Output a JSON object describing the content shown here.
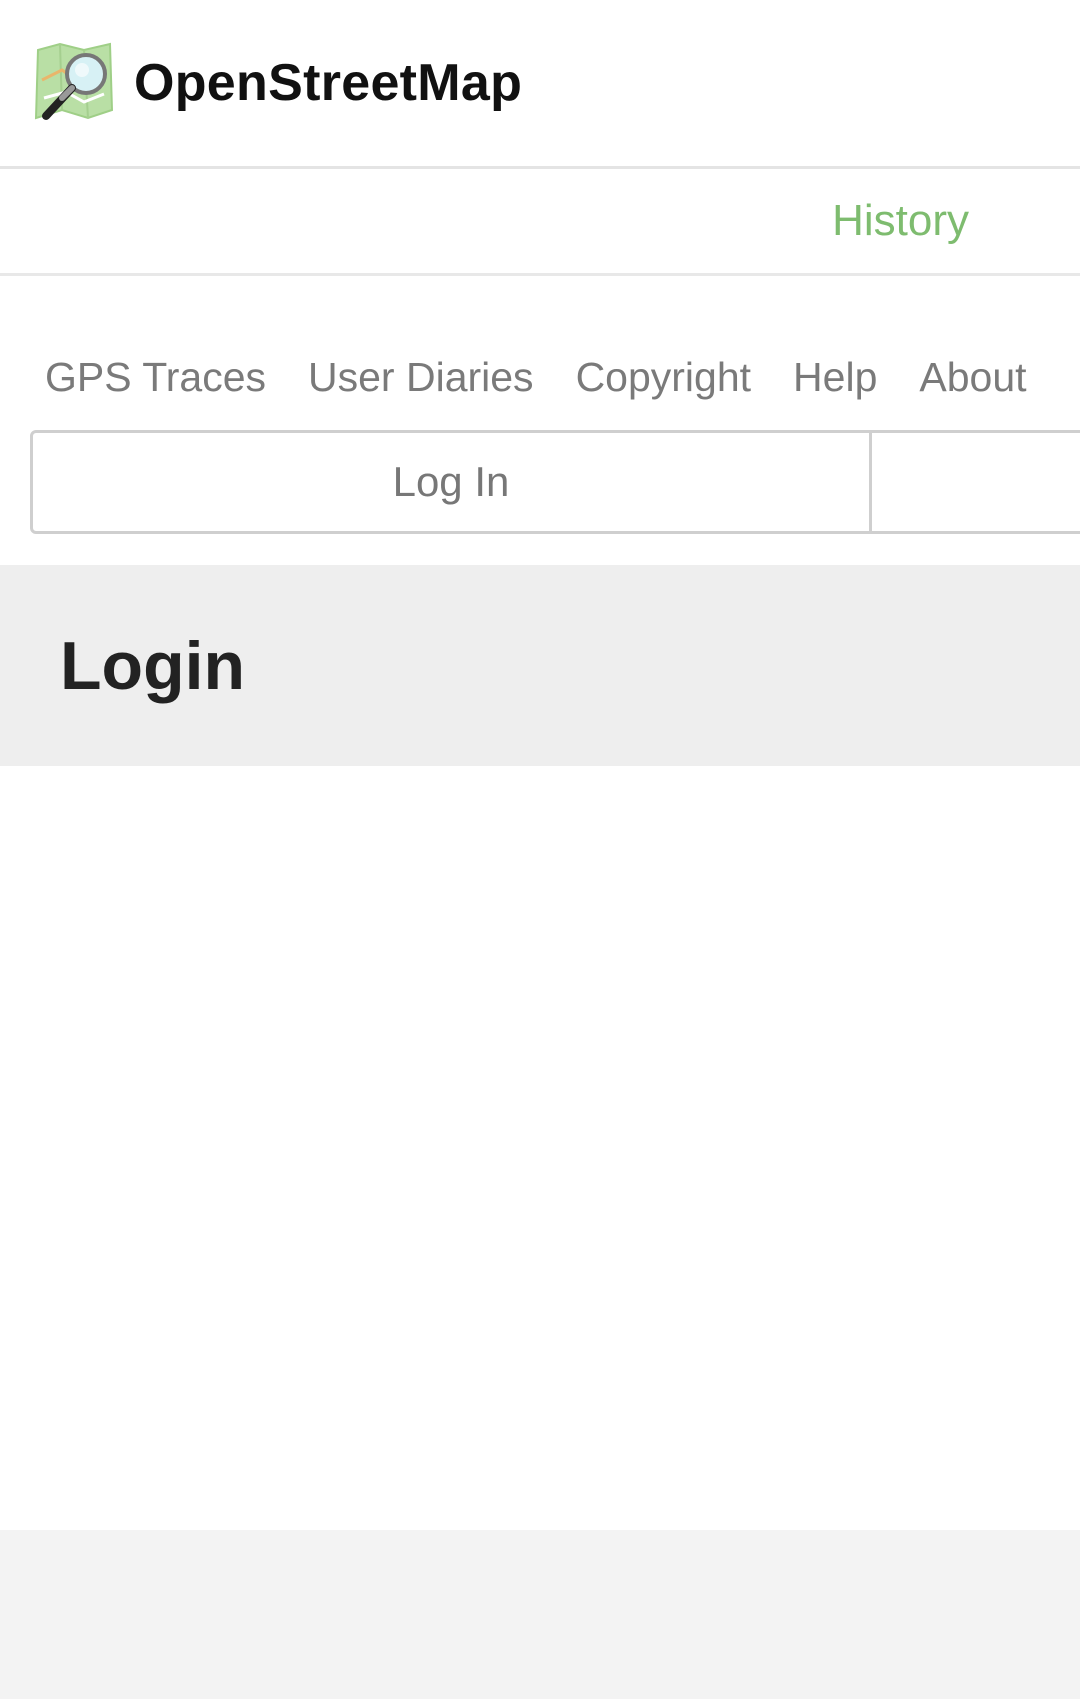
{
  "header": {
    "brand": "OpenStreetMap",
    "logo_icon": "osm-map-magnifier-icon"
  },
  "tabs": {
    "history": "History"
  },
  "nav": {
    "links": [
      "GPS Traces",
      "User Diaries",
      "Copyright",
      "Help",
      "About"
    ]
  },
  "auth": {
    "login_label": "Log In",
    "signup_label": ""
  },
  "page": {
    "title": "Login"
  },
  "colors": {
    "accent_green": "#7ebc6f",
    "title_band_bg": "#eeeeee",
    "footer_bg": "#f3f3f3"
  }
}
